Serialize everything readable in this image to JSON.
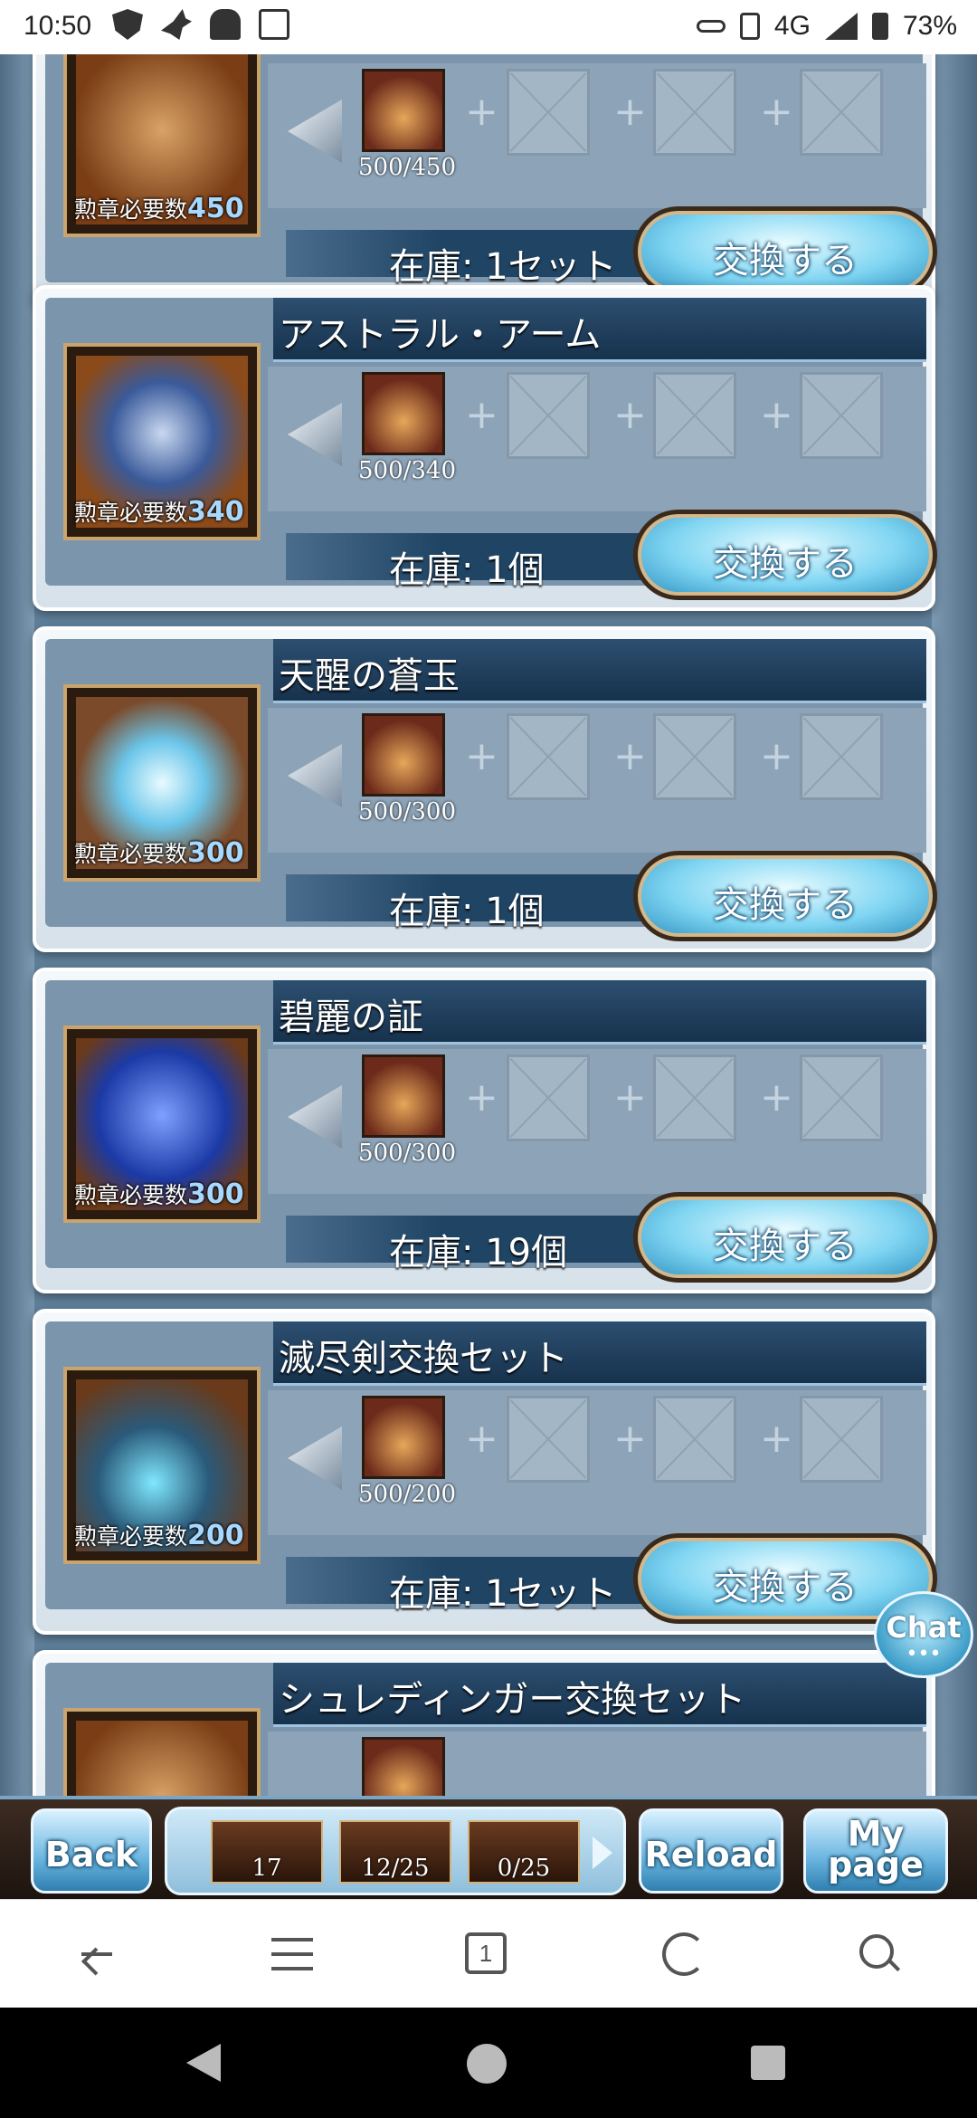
{
  "status_bar": {
    "time": "10:50",
    "network": "4G",
    "battery": "73%"
  },
  "cards": [
    {
      "title": "",
      "requirement_label": "勲章必要数",
      "requirement_value": "450",
      "medal_count": "500/450",
      "stock": "在庫: 1セット",
      "exchange_label": "交換する",
      "item_icon": "gold-bars-icon"
    },
    {
      "title": "アストラル・アーム",
      "requirement_label": "勲章必要数",
      "requirement_value": "340",
      "medal_count": "500/340",
      "stock": "在庫: 1個",
      "exchange_label": "交換する",
      "item_icon": "crystal-icon"
    },
    {
      "title": "天醒の蒼玉",
      "requirement_label": "勲章必要数",
      "requirement_value": "300",
      "medal_count": "500/300",
      "stock": "在庫: 1個",
      "exchange_label": "交換する",
      "item_icon": "blue-orb-icon"
    },
    {
      "title": "碧麗の証",
      "requirement_label": "勲章必要数",
      "requirement_value": "300",
      "medal_count": "500/300",
      "stock": "在庫: 19個",
      "exchange_label": "交換する",
      "item_icon": "scroll-icon"
    },
    {
      "title": "滅尽剣交換セット",
      "requirement_label": "勲章必要数",
      "requirement_value": "200",
      "medal_count": "500/200",
      "stock": "在庫: 1セット",
      "exchange_label": "交換する",
      "item_icon": "sword-icon"
    },
    {
      "title": "シュレディンガー交換セット",
      "requirement_label": "",
      "requirement_value": "",
      "medal_count": "",
      "stock": "",
      "exchange_label": "",
      "item_icon": "weapon-icon"
    }
  ],
  "chat": {
    "label": "Chat",
    "dots": "•••"
  },
  "game_bar": {
    "back_label": "Back",
    "reload_label": "Reload",
    "mypage_label_1": "My",
    "mypage_label_2": "page",
    "tray": [
      "17",
      "12/25",
      "0/25"
    ]
  },
  "browser": {
    "tab_count": "1"
  }
}
